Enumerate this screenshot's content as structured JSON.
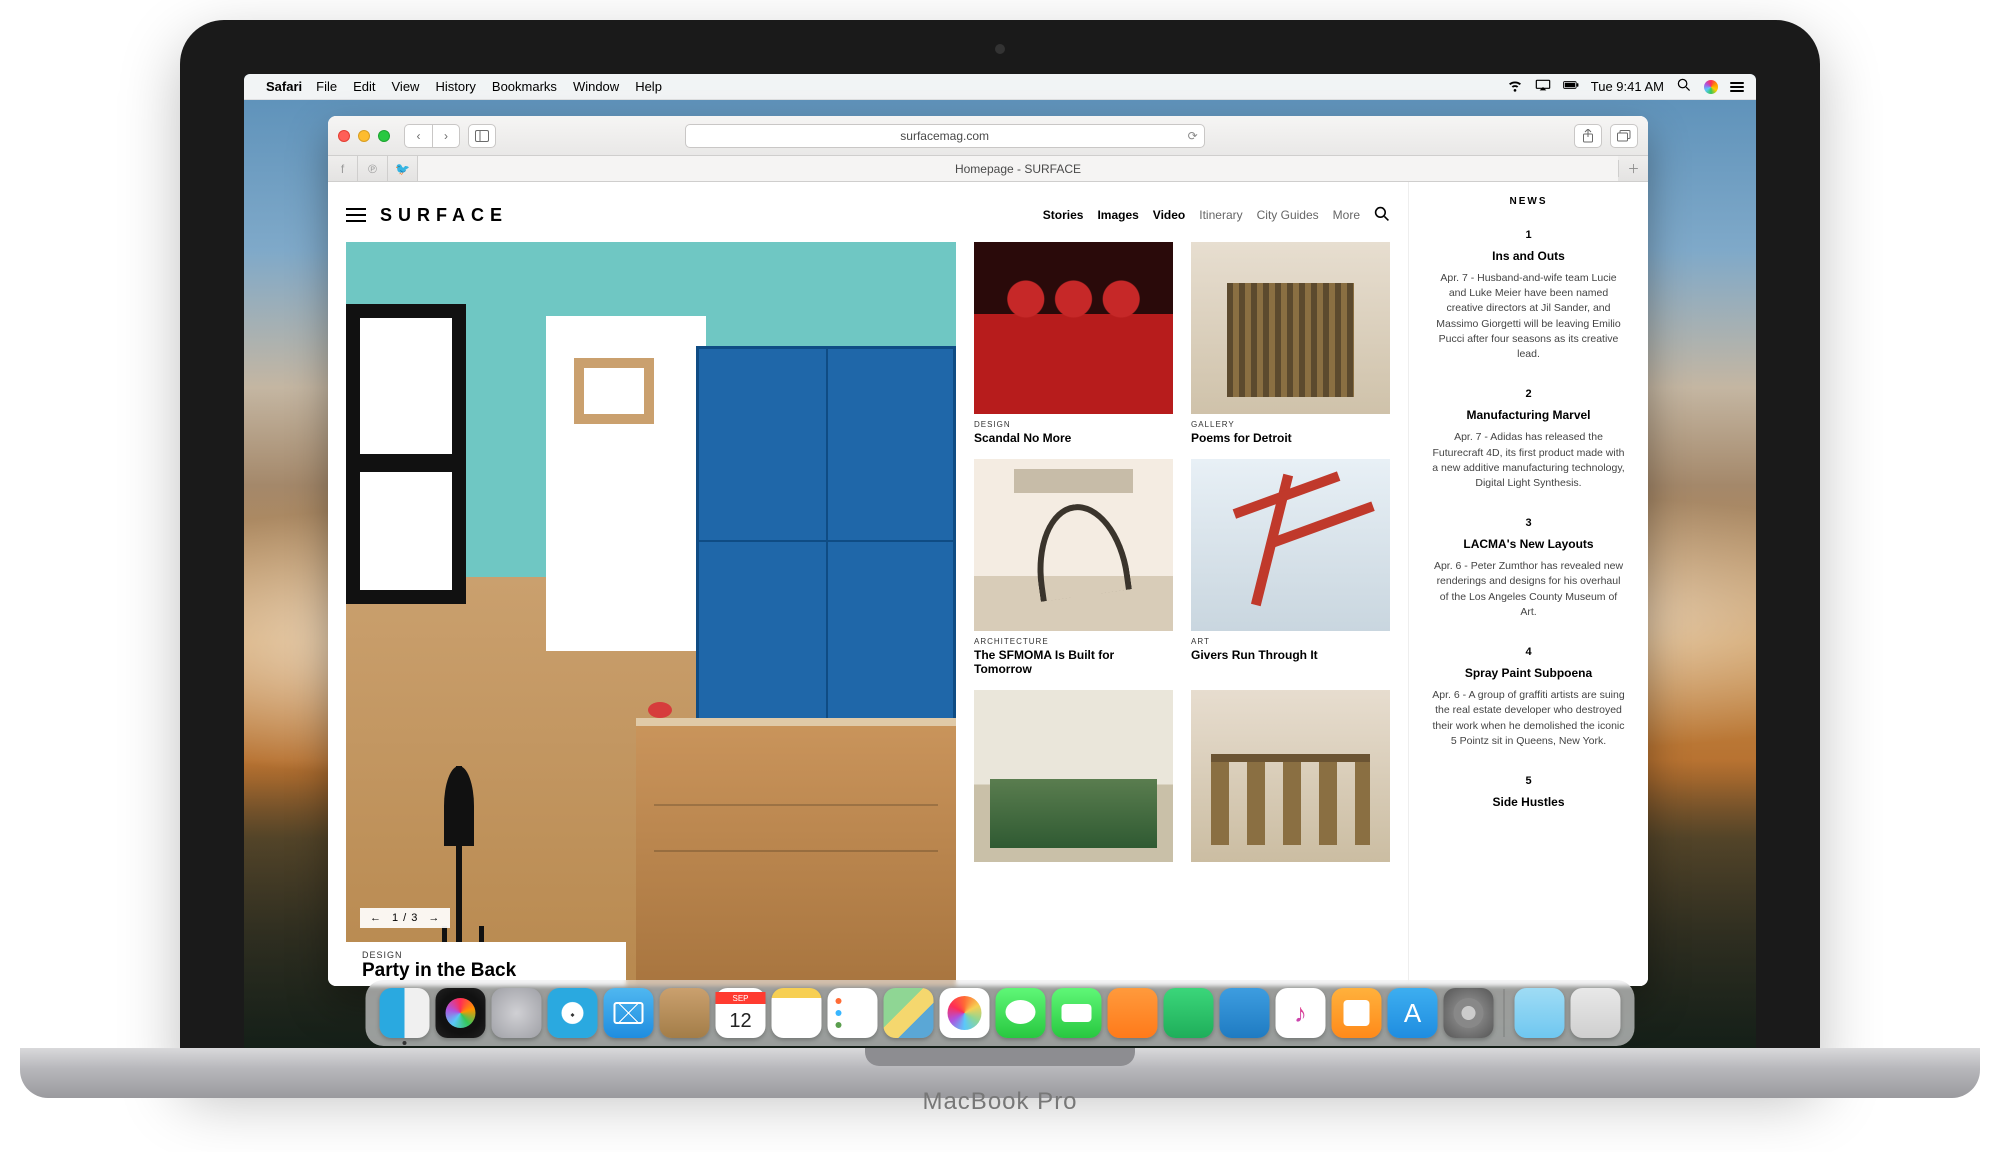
{
  "laptop_label": "MacBook Pro",
  "menubar": {
    "app": "Safari",
    "items": [
      "File",
      "Edit",
      "View",
      "History",
      "Bookmarks",
      "Window",
      "Help"
    ],
    "time": "Tue 9:41 AM"
  },
  "safari": {
    "url": "surfacemag.com",
    "tab_title": "Homepage - SURFACE"
  },
  "page": {
    "brand": "SURFACE",
    "nav_bold": [
      "Stories",
      "Images",
      "Video"
    ],
    "nav_light": [
      "Itinerary",
      "City Guides",
      "More"
    ],
    "hero": {
      "category": "DESIGN",
      "title": "Party in the Back",
      "pager": "1 / 3"
    },
    "cards": [
      {
        "category": "DESIGN",
        "title": "Scandal No More"
      },
      {
        "category": "GALLERY",
        "title": "Poems for Detroit"
      },
      {
        "category": "ARCHITECTURE",
        "title": "The SFMOMA Is Built for Tomorrow"
      },
      {
        "category": "ART",
        "title": "Givers Run Through It"
      },
      {
        "category": "",
        "title": ""
      },
      {
        "category": "",
        "title": ""
      }
    ],
    "sidebar": {
      "heading": "NEWS",
      "items": [
        {
          "num": "1",
          "title": "Ins and Outs",
          "body": "Apr. 7 - Husband-and-wife team Lucie and Luke Meier have been named creative directors at Jil Sander, and Massimo Giorgetti will be leaving Emilio Pucci after four seasons as its creative lead."
        },
        {
          "num": "2",
          "title": "Manufacturing Marvel",
          "body": "Apr. 7 - Adidas has released the Futurecraft 4D, its first product made with a new additive manufacturing technology, Digital Light Synthesis."
        },
        {
          "num": "3",
          "title": "LACMA's New Layouts",
          "body": "Apr. 6 - Peter Zumthor has revealed new renderings and designs for his overhaul of the Los Angeles County Museum of Art."
        },
        {
          "num": "4",
          "title": "Spray Paint Subpoena",
          "body": "Apr. 6 - A group of graffiti artists are suing the real estate developer who destroyed their work when he demolished the iconic 5 Pointz sit in Queens, New York."
        },
        {
          "num": "5",
          "title": "Side Hustles",
          "body": ""
        }
      ]
    }
  },
  "dock": [
    "Finder",
    "Siri",
    "Launchpad",
    "Safari",
    "Mail",
    "Contacts",
    "Calendar",
    "Notes",
    "Reminders",
    "Maps",
    "Photos",
    "Messages",
    "FaceTime",
    "Pages",
    "Numbers",
    "Keynote",
    "iTunes",
    "iBooks",
    "App Store",
    "System Preferences",
    "Downloads",
    "Trash"
  ]
}
